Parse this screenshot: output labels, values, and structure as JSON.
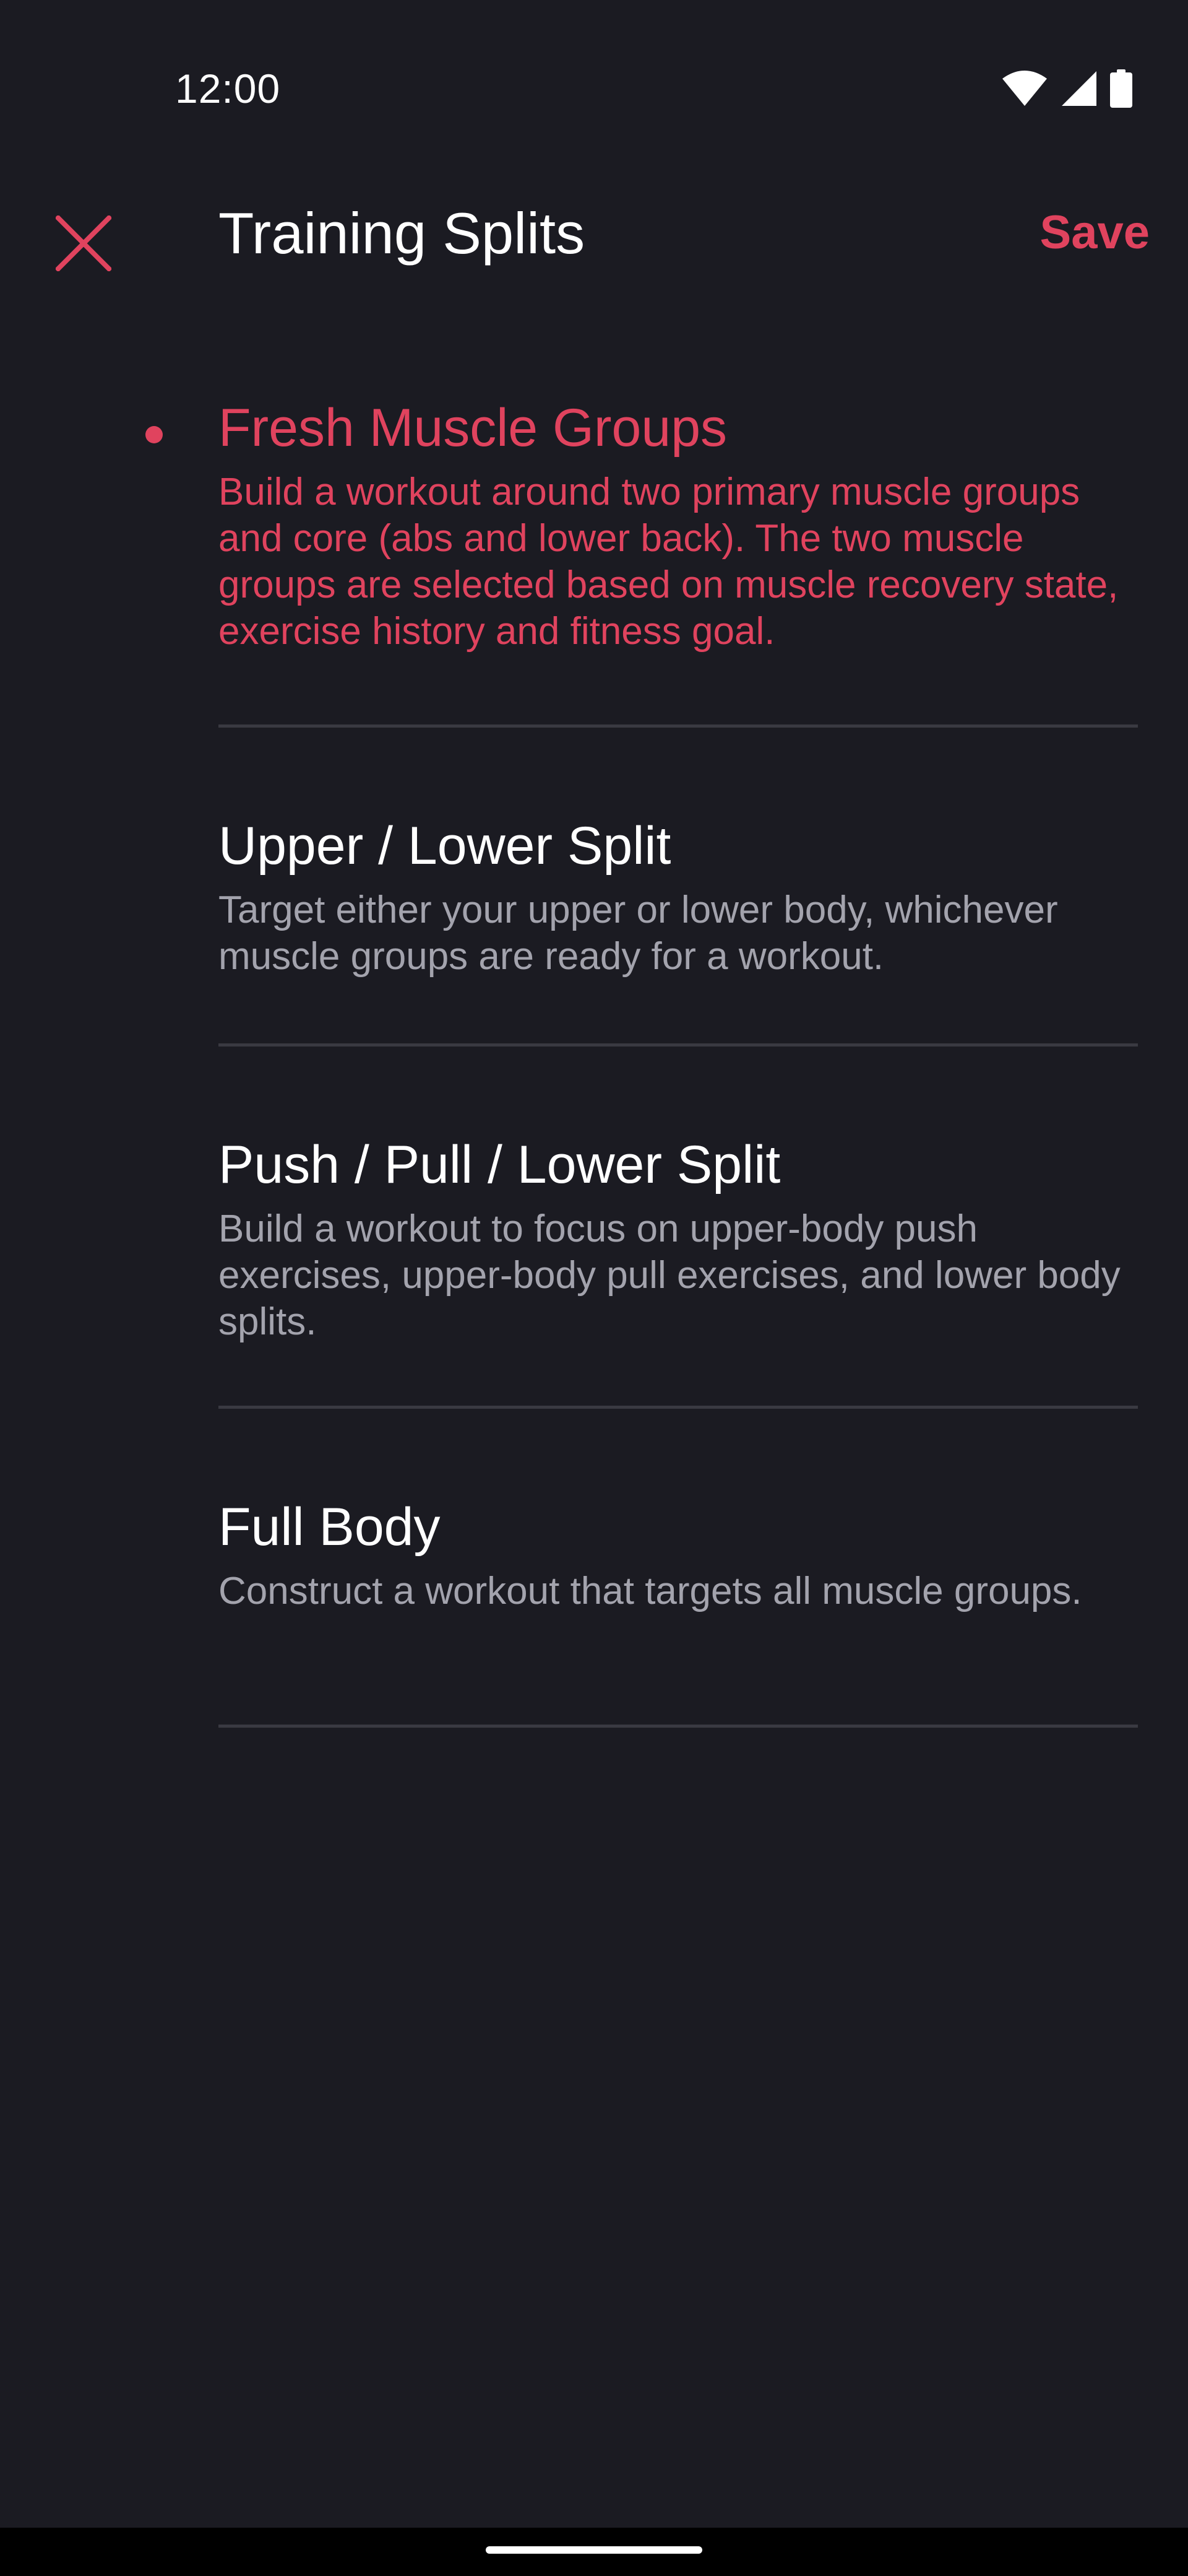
{
  "status_bar": {
    "time": "12:00",
    "icons": [
      "wifi-icon",
      "signal-icon",
      "battery-icon"
    ]
  },
  "app_bar": {
    "close_icon": "close-icon",
    "title": "Training Splits",
    "save_label": "Save"
  },
  "colors": {
    "accent": "#e0435e",
    "background": "#1b1b22",
    "divider": "#3a3a42",
    "secondary_text": "#a3a3ad"
  },
  "options": [
    {
      "title": "Fresh Muscle Groups",
      "description": "Build a workout around two primary muscle groups and core (abs and lower back). The two muscle groups are selected based on muscle recovery state, exercise history and fitness goal.",
      "selected": true
    },
    {
      "title": "Upper / Lower Split",
      "description": "Target either your upper or lower body, whichever muscle groups are ready for a workout.",
      "selected": false
    },
    {
      "title": "Push / Pull / Lower Split",
      "description": "Build a workout to focus on upper-body push exercises, upper-body pull exercises, and lower body splits.",
      "selected": false
    },
    {
      "title": "Full Body",
      "description": "Construct a workout that targets all muscle groups.",
      "selected": false
    }
  ]
}
